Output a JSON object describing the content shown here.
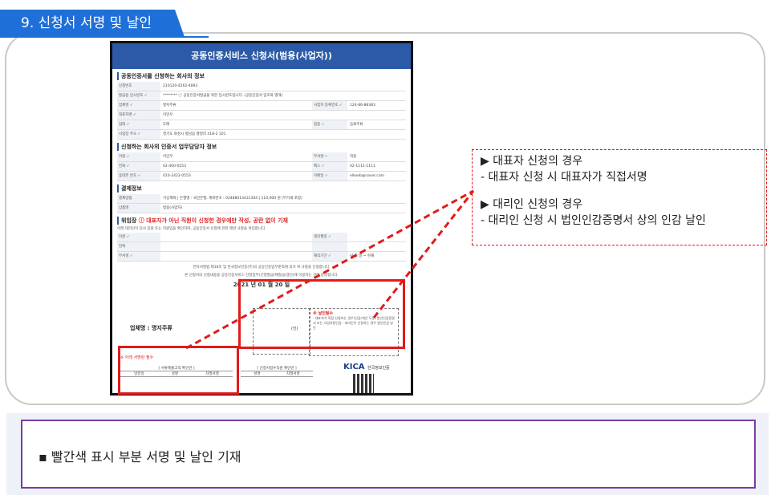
{
  "tab_title": "9. 신청서 서명 및 날인",
  "document": {
    "header": "공동인증서비스 신청서(범용(사업자))",
    "section1": "공동인증서를 신청하는 회사의 정보",
    "rows1": [
      {
        "k": "신청번호",
        "v": "210120-4262-4893"
      },
      {
        "k": "발급용 임시번호 ✓",
        "v": "********  ⓘ 공동인증서발급을 위한 임시번호입니다. (공동인증서 암호와 별개)"
      },
      {
        "k": "업체명 ✓",
        "v": "명지주류"
      },
      {
        "k": "대표자명 ✓",
        "v": "이민우"
      },
      {
        "k": "업태 ✓",
        "v": "도매"
      },
      {
        "k": "사업장 주소 ✓",
        "v": "경기도 화성시 향남읍 행정리 418-2 101"
      }
    ],
    "biz_no_label": "사업자 등록번호 ✓",
    "biz_no": "124-86-88383",
    "item_label": "업종 ✓",
    "item_value": "음료주류",
    "section2": "신청하는 회사의 인증서 업무담당자 정보",
    "rows2": [
      {
        "k": "이름 ✓",
        "v": "이민우",
        "k2": "부서명 ✓",
        "v2": "직원"
      },
      {
        "k": "전화 ✓",
        "v": "02-400-0553",
        "k2": "팩스 ✓",
        "v2": "02-1111-1111"
      },
      {
        "k": "휴대폰 번호 ✓",
        "v": "010-2422-0553",
        "k2": "이메일 ✓",
        "v2": "elkoeb@naver.com"
      }
    ],
    "section3": "결제정보",
    "rows3": [
      {
        "k": "결제방법",
        "v": "가상계좌 | 은행명 : 국민은행, 계좌번호 : 02488013431304 | 110,000 원 (부가세 포함)"
      },
      {
        "k": "상품명",
        "v": "범용(사업자)"
      }
    ],
    "section4": "위임장",
    "section4_warn": "ⓘ 대표자가 아닌 직원이 신청한 경우에만 작성, 공란 없이 기재",
    "section4_note": "아래 대리인이 당사 임원 또는 직원임을 확인하며, 공동인증서 신청에 관한 제반 사항을 위임합니다.",
    "rows4": [
      {
        "k": "이름 ✓",
        "v": "",
        "k2": "생년월일 ✓",
        "v2": ""
      },
      {
        "k": "전화",
        "v": "",
        "k2": "",
        "v2": ""
      },
      {
        "k": "부서명 ✓",
        "v": "",
        "k2": "재직기간 ✓",
        "v2": "년    월    일 ~ 현재"
      }
    ],
    "foot_text1": "전자서명법 제18조 및 한국정보인증(주)의 공동인증업무준칙에 의거 위 사항을 신청합니다.",
    "foot_text2": "본 신청서의 신청내용을 공동인증서비스 신청업무(신청발급/재발급/갱신)에 이용하는 것에 동의합니다.",
    "date": "2021 년   01 월   20 일",
    "company": "업체명 : 명지주류",
    "seal_mark": "(인)",
    "notice_title": "※ 날인필수",
    "notice_body": "- 대표자가 직접 신청하는 경우(인감/개인 도장) 법인인감증명서 또는 사업자용인감 - 대리인이 신청하는 경우 법인인감 날인",
    "sig_warn": "※ 아래 서명란 필수",
    "sig_title1": "[ 서류제출고객 확인란 ]",
    "sig_title2": "[ 신청서접수직원 확인란 ]",
    "sig_cols1": [
      "방문일",
      "성명",
      "자필서명"
    ],
    "sig_cols2": [
      "성명",
      "자필서명"
    ],
    "kica": "KICA",
    "kica_sub": "한국정보인증"
  },
  "callout": {
    "line1": "▶ 대표자 신청의 경우",
    "line2": "- 대표자 신청 시 대표자가 직접서명",
    "line3": "▶ 대리인 신청의 경우",
    "line4": "- 대리인 신청 시 법인인감증명서 상의 인감 날인"
  },
  "bottom_note": "▪   빨간색 표시 부분 서명 및 날인 기재",
  "colors": {
    "accent": "#1f6fd9",
    "highlight": "#e11b1b",
    "frame": "#7a3aa8"
  }
}
